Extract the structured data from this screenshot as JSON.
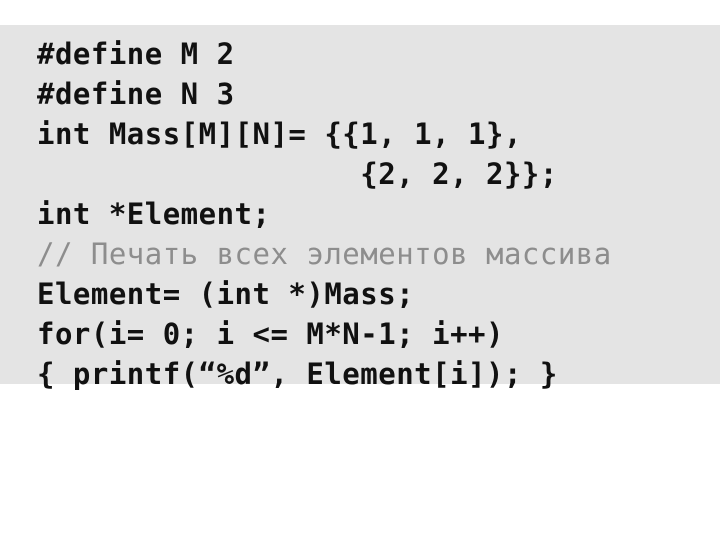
{
  "slide": {
    "background_color": "#ffffff",
    "code_panel": {
      "background_color": "#e4e4e4",
      "code_color": "#111111",
      "comment_color": "#8d8d8d",
      "language": "C",
      "lines": [
        {
          "text": "#define M 2",
          "kind": "code"
        },
        {
          "text": "#define N 3",
          "kind": "code"
        },
        {
          "text": "int Mass[M][N]= {{1, 1, 1},",
          "kind": "code"
        },
        {
          "text": "                  {2, 2, 2}};",
          "kind": "code"
        },
        {
          "text": "int *Element;",
          "kind": "code"
        },
        {
          "text": "// Печать всех элементов массива",
          "kind": "comment"
        },
        {
          "text": "Element= (int *)Mass;",
          "kind": "code"
        },
        {
          "text": "for(i= 0; i <= M*N-1; i++)",
          "kind": "code"
        },
        {
          "text": "{ printf(“%d”, Element[i]); }",
          "kind": "code"
        }
      ]
    }
  }
}
